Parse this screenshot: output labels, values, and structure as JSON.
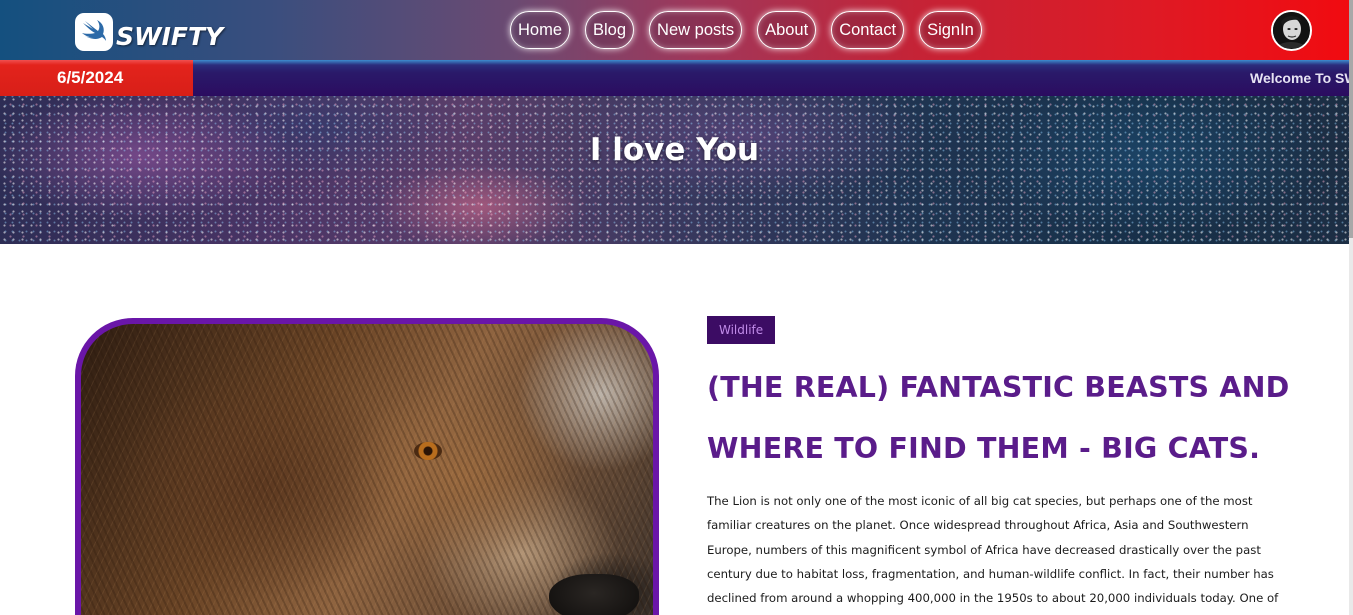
{
  "brand": {
    "name": "SWIFTY"
  },
  "nav": {
    "items": [
      "Home",
      "Blog",
      "New posts",
      "About",
      "Contact",
      "SignIn"
    ]
  },
  "ticker": {
    "date": "6/5/2024",
    "marquee": "Welcome To SW"
  },
  "hero": {
    "title": "I love You"
  },
  "article": {
    "tag": "Wildlife",
    "title": "(THE REAL) FANTASTIC BEASTS AND WHERE TO FIND THEM - BIG CATS.",
    "body": "The Lion is not only one of the most iconic of all big cat species, but perhaps one of the most familiar creatures on the planet. Once widespread throughout Africa, Asia and Southwestern Europe, numbers of this magnificent symbol of Africa have decreased drastically over the past century due to habitat loss, fragmentation, and human-wildlife conflict. In fact, their number has declined from around a whopping 400,000 in the 1950s to about 20,000 individuals today. One of the largest in the feline family (second"
  },
  "colors": {
    "accent_purple": "#5a1c8a",
    "frame_purple": "#6a16a8",
    "tag_bg": "#3c0c64",
    "date_red": "#d81f18",
    "ticker_bg": "#2b0c60"
  },
  "icons": {
    "logo": "swift-bird-icon",
    "avatar": "user-avatar"
  }
}
